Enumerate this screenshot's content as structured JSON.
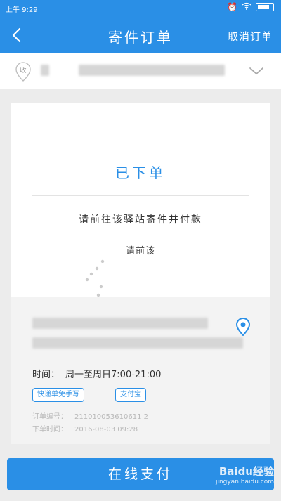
{
  "status_bar": {
    "time": "上午 9:29"
  },
  "header": {
    "title": "寄件订单",
    "cancel_label": "取消订单"
  },
  "address": {
    "tag": "收"
  },
  "order": {
    "status": "已下单",
    "instruction": "请前往该驿站寄件并付款",
    "station_prefix": "请前该"
  },
  "details": {
    "hours_label": "时间：",
    "hours_value": "周一至周日7:00-21:00",
    "tag_free": "快递单免手写",
    "tag_alipay": "支付宝",
    "order_no_label": "订单编号：",
    "order_no_value": "211010053610611 2",
    "order_time_label": "下单时间：",
    "order_time_value": "2016-08-03  09:28"
  },
  "footer": {
    "pay_label": "在线支付"
  },
  "watermark": {
    "brand": "Baidu经验",
    "url": "jingyan.baidu.com"
  },
  "colors": {
    "accent": "#2a8fe6",
    "background": "#ececec"
  }
}
